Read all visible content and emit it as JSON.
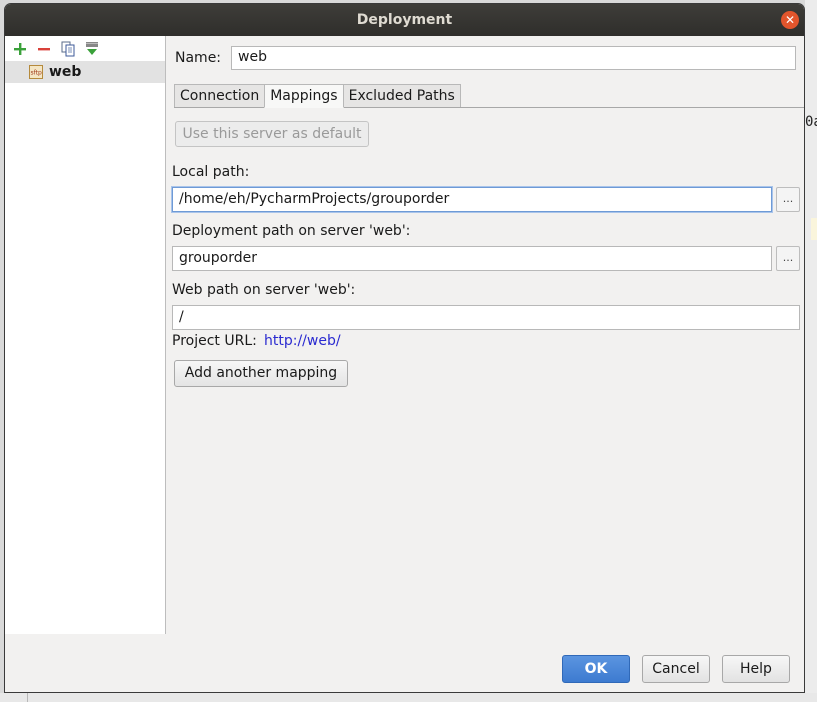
{
  "window": {
    "title": "Deployment"
  },
  "background": {
    "peek_text": "0a"
  },
  "servers": [
    {
      "label": "web",
      "icon": "sftp-server-icon"
    }
  ],
  "toolbar": {
    "add_icon": "plus-icon",
    "remove_icon": "minus-icon",
    "copy_icon": "copy-icon",
    "default_icon": "set-default-icon"
  },
  "form": {
    "name_label": "Name:",
    "name_value": "web"
  },
  "tabs": [
    {
      "label": "Connection",
      "active": false
    },
    {
      "label": "Mappings",
      "active": true
    },
    {
      "label": "Excluded Paths",
      "active": false
    }
  ],
  "mappings": {
    "use_default_label": "Use this server as default",
    "local_path_label": "Local path:",
    "local_path_value": "/home/eh/PycharmProjects/grouporder",
    "deployment_path_label": "Deployment path on server 'web':",
    "deployment_path_value": "grouporder",
    "web_path_label": "Web path on server 'web':",
    "web_path_value": "/",
    "project_url_label": "Project URL:",
    "project_url_value": "http://web/",
    "add_mapping_label": "Add another mapping",
    "browse_label": "..."
  },
  "footer": {
    "ok_label": "OK",
    "cancel_label": "Cancel",
    "help_label": "Help"
  },
  "colors": {
    "accent": "#3d7bd0",
    "link": "#2a2ad0",
    "titlebar": "#33322f",
    "close": "#e2552c"
  }
}
